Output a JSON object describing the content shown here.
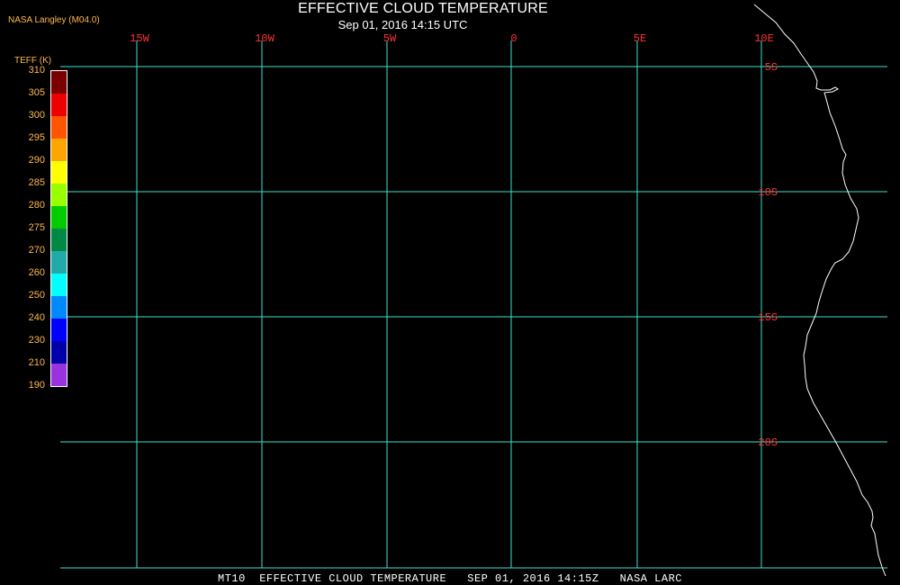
{
  "header": {
    "title": "EFFECTIVE CLOUD TEMPERATURE",
    "subtitle": "Sep 01, 2016 14:15 UTC",
    "agency": "NASA Langley (M04.0)"
  },
  "colorbar": {
    "title": "TEFF (K)",
    "labels": [
      "310",
      "305",
      "300",
      "295",
      "290",
      "285",
      "280",
      "275",
      "270",
      "260",
      "250",
      "240",
      "230",
      "210",
      "190"
    ],
    "colors": [
      "#7a0000",
      "#ee0000",
      "#ff5500",
      "#ffa500",
      "#ffff00",
      "#99ff00",
      "#00cc00",
      "#008844",
      "#22aaaa",
      "#00ffff",
      "#0088ff",
      "#0000ff",
      "#0000aa",
      "#9933dd"
    ]
  },
  "map": {
    "grid_color": "#40e0d0",
    "label_color": "#ff3333",
    "coast_color": "#ffffff",
    "lon_labels": [
      "15W",
      "10W",
      "5W",
      "0",
      "5E",
      "10E"
    ],
    "lat_labels": [
      "5S",
      "10S",
      "15S",
      "20S"
    ]
  },
  "footer": {
    "text": "MT10  EFFECTIVE CLOUD TEMPERATURE   SEP 01, 2016 14:15Z   NASA LARC"
  }
}
